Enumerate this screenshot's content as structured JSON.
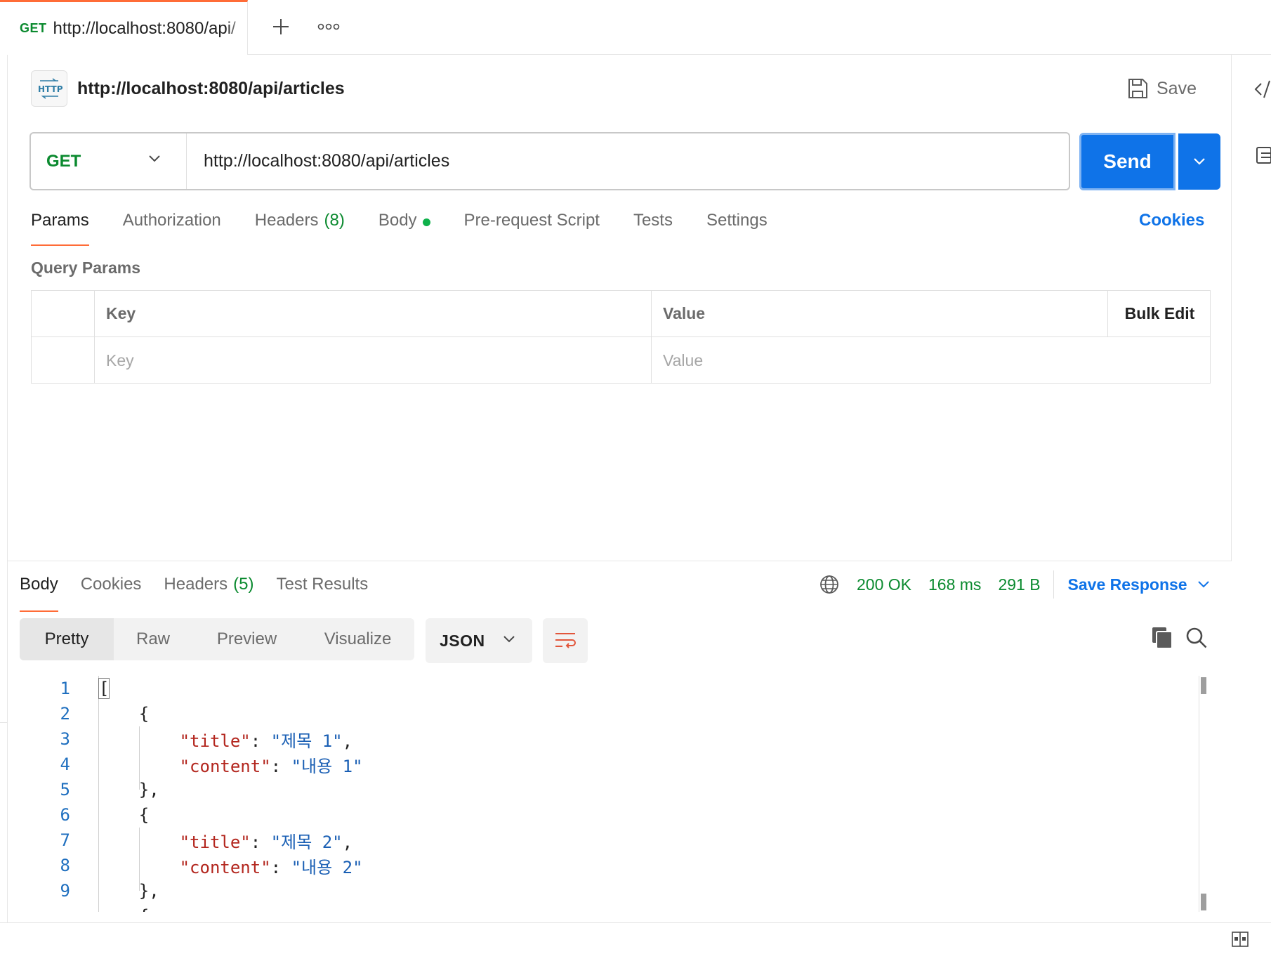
{
  "tab": {
    "method": "GET",
    "title": "http://localhost:8080/api/"
  },
  "request": {
    "name": "http://localhost:8080/api/articles",
    "save_label": "Save",
    "method": "GET",
    "url": "http://localhost:8080/api/articles",
    "send_label": "Send"
  },
  "req_tabs": [
    {
      "label": "Params"
    },
    {
      "label": "Authorization"
    },
    {
      "label": "Headers",
      "count": "(8)"
    },
    {
      "label": "Body"
    },
    {
      "label": "Pre-request Script"
    },
    {
      "label": "Tests"
    },
    {
      "label": "Settings"
    }
  ],
  "cookies_label": "Cookies",
  "query_params": {
    "label": "Query Params",
    "columns": {
      "key": "Key",
      "value": "Value",
      "bulk_edit": "Bulk Edit"
    },
    "placeholders": {
      "key": "Key",
      "value": "Value"
    }
  },
  "response": {
    "tabs": [
      {
        "label": "Body"
      },
      {
        "label": "Cookies"
      },
      {
        "label": "Headers",
        "count": "(5)"
      },
      {
        "label": "Test Results"
      }
    ],
    "status": "200 OK",
    "time": "168 ms",
    "size": "291 B",
    "save_response": "Save Response",
    "views": [
      "Pretty",
      "Raw",
      "Preview",
      "Visualize"
    ],
    "format": "JSON",
    "line_numbers": [
      "1",
      "2",
      "3",
      "4",
      "5",
      "6",
      "7",
      "8",
      "9"
    ],
    "body": [
      {
        "key": "title",
        "value": "제목 1"
      },
      {
        "key": "content",
        "value": "내용 1"
      },
      {
        "key": "title",
        "value": "제목 2"
      },
      {
        "key": "content",
        "value": "내용 2"
      }
    ]
  },
  "colors": {
    "accent": "#ff6c37",
    "primary": "#0f73e8",
    "success": "#0b8a2f"
  },
  "icons": [
    "plus-icon",
    "more-icon",
    "http-icon",
    "save-icon",
    "chevron-down-icon",
    "globe-icon",
    "wrap-lines-icon",
    "copy-icon",
    "search-icon",
    "code-icon",
    "info-icon",
    "layout-icon"
  ]
}
